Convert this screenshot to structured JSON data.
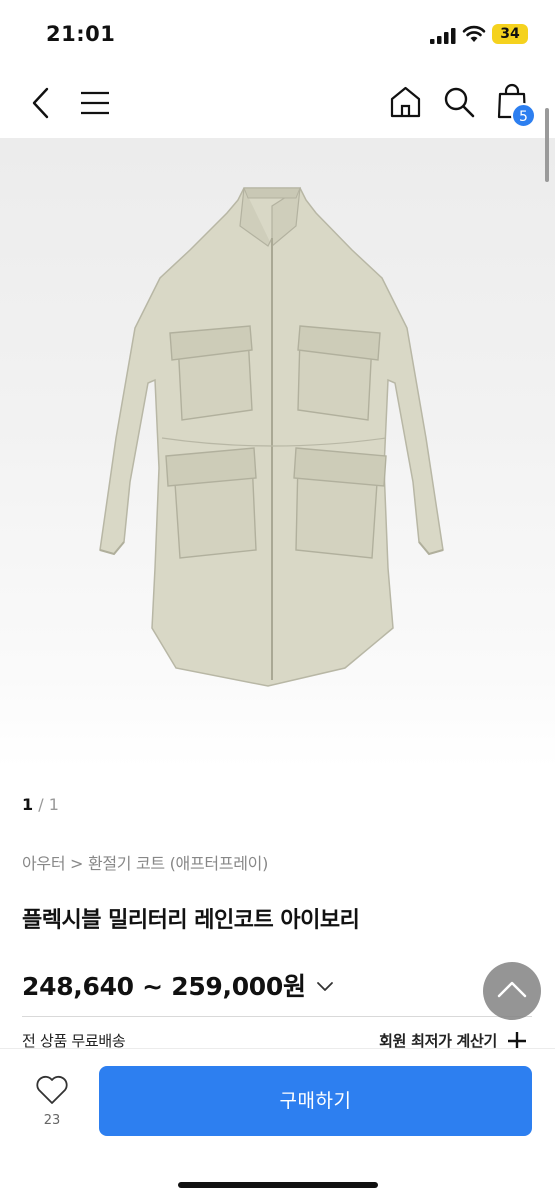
{
  "status_bar": {
    "time": "21:01",
    "battery": "34",
    "icons": [
      "signal-icon",
      "wifi-icon",
      "battery-icon"
    ]
  },
  "nav": {
    "icons": [
      "back-icon",
      "menu-icon",
      "home-icon",
      "search-icon",
      "bag-icon"
    ],
    "cart_count": "5"
  },
  "gallery": {
    "current": "1",
    "separator": "/",
    "total": "1"
  },
  "product": {
    "breadcrumb": "아우터 > 환절기 코트 (애프터프레이)",
    "title": "플렉시블 밀리터리 레인코트 아이보리",
    "price_range": "248,640 ~ 259,000원"
  },
  "info": {
    "shipping": "전 상품 무료배송",
    "member_calc": "회원 최저가 계산기"
  },
  "bottom_bar": {
    "like_count": "23",
    "buy_label": "구매하기"
  },
  "colors": {
    "accent": "#2d7ff0",
    "battery": "#f5d21e",
    "coat": "#d9d8c6"
  }
}
